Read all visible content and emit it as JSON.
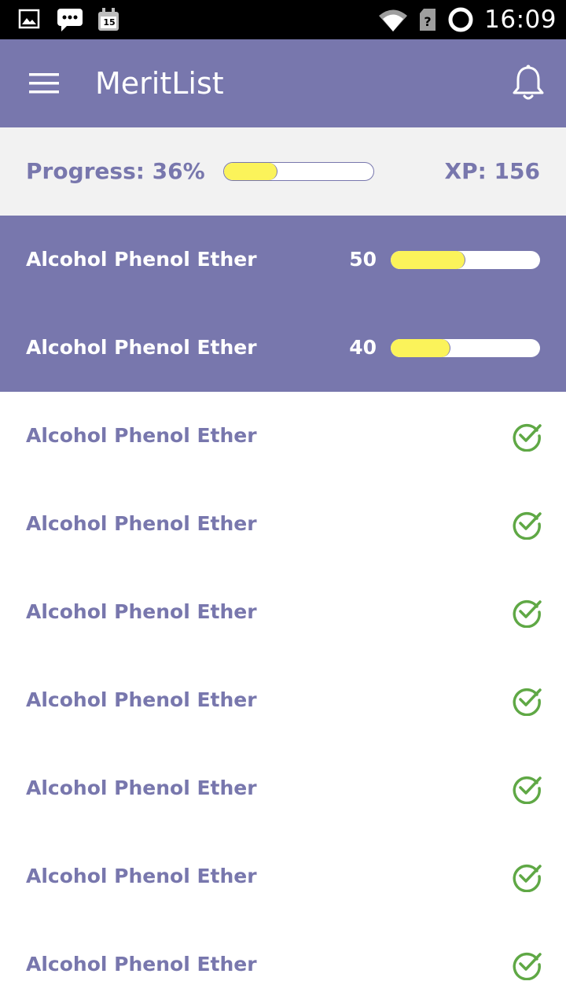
{
  "status_bar": {
    "time": "16:09",
    "icons": [
      "image-icon",
      "chat-icon",
      "calendar-icon",
      "wifi-icon",
      "no-sim-icon",
      "sync-icon"
    ],
    "calendar_day": "15"
  },
  "app_bar": {
    "title": "MeritList",
    "menu_icon": "hamburger-menu-icon",
    "notification_icon": "bell-icon"
  },
  "progress": {
    "label": "Progress: 36%",
    "percent": 36,
    "xp_label": "XP: 156"
  },
  "active_topics": [
    {
      "name": "Alcohol Phenol Ether",
      "score": "50",
      "fill_percent": 50
    },
    {
      "name": "Alcohol Phenol Ether",
      "score": "40",
      "fill_percent": 40
    }
  ],
  "completed_topics": [
    {
      "name": "Alcohol Phenol Ether",
      "icon": "check-circle-icon"
    },
    {
      "name": "Alcohol Phenol Ether",
      "icon": "check-circle-icon"
    },
    {
      "name": "Alcohol Phenol Ether",
      "icon": "check-circle-icon"
    },
    {
      "name": "Alcohol Phenol Ether",
      "icon": "check-circle-icon"
    },
    {
      "name": "Alcohol Phenol Ether",
      "icon": "check-circle-icon"
    },
    {
      "name": "Alcohol Phenol Ether",
      "icon": "check-circle-icon"
    },
    {
      "name": "Alcohol Phenol Ether",
      "icon": "check-circle-icon"
    }
  ],
  "colors": {
    "primary": "#7877ad",
    "progress_fill": "#fbf35a",
    "header_background": "#f2f2f2",
    "check_green": "#5fa845",
    "status_bar": "#000000"
  }
}
